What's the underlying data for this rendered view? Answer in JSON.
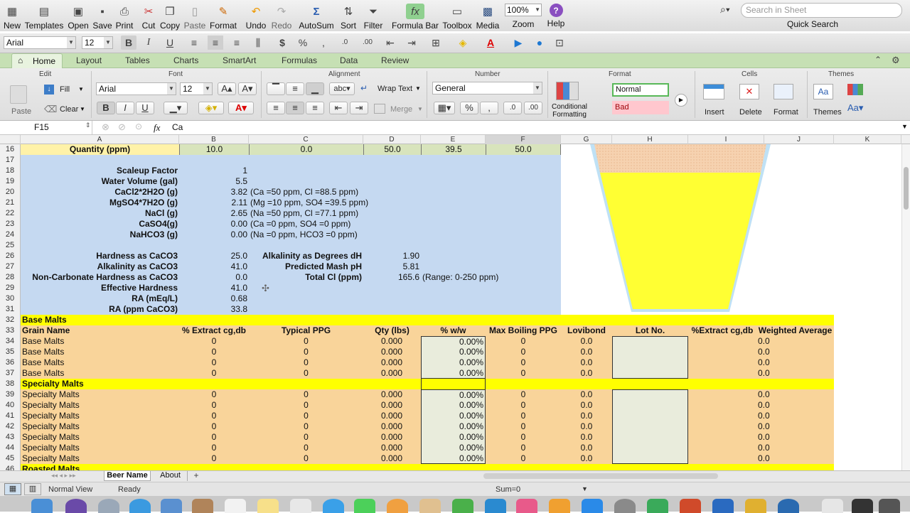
{
  "toolbar": {
    "items": [
      {
        "label": "New",
        "icon": "new-workbook-icon"
      },
      {
        "label": "Templates",
        "icon": "templates-icon"
      },
      {
        "label": "Open",
        "icon": "open-icon"
      },
      {
        "label": "Save",
        "icon": "save-icon"
      },
      {
        "label": "Print",
        "icon": "print-icon"
      },
      {
        "label": "Cut",
        "icon": "cut-icon"
      },
      {
        "label": "Copy",
        "icon": "copy-icon"
      },
      {
        "label": "Paste",
        "icon": "paste-icon"
      },
      {
        "label": "Format",
        "icon": "format-painter-icon"
      },
      {
        "label": "Undo",
        "icon": "undo-icon"
      },
      {
        "label": "Redo",
        "icon": "redo-icon"
      },
      {
        "label": "AutoSum",
        "icon": "autosum-icon"
      },
      {
        "label": "Sort",
        "icon": "sort-icon"
      },
      {
        "label": "Filter",
        "icon": "filter-icon"
      },
      {
        "label": "Formula Bar",
        "icon": "formula-bar-icon"
      },
      {
        "label": "Toolbox",
        "icon": "toolbox-icon"
      },
      {
        "label": "Media",
        "icon": "media-icon"
      },
      {
        "label": "Zoom",
        "icon": "zoom-icon"
      },
      {
        "label": "Help",
        "icon": "help-icon"
      }
    ],
    "zoom_value": "100%",
    "search_placeholder": "Search in Sheet",
    "quick_search": "Quick Search"
  },
  "format_bar": {
    "font": "Arial",
    "size": "12"
  },
  "ribbon": {
    "tabs": [
      "Home",
      "Layout",
      "Tables",
      "Charts",
      "SmartArt",
      "Formulas",
      "Data",
      "Review"
    ],
    "groups": {
      "edit": "Edit",
      "font": "Font",
      "alignment": "Alignment",
      "number": "Number",
      "format": "Format",
      "cells": "Cells",
      "themes": "Themes"
    },
    "paste": "Paste",
    "fill": "Fill",
    "clear": "Clear",
    "font": "Arial",
    "size": "12",
    "wrap_text": "Wrap Text",
    "merge": "Merge",
    "number_format": "General",
    "conditional_formatting": "Conditional Formatting",
    "style_normal": "Normal",
    "style_bad": "Bad",
    "insert": "Insert",
    "delete": "Delete",
    "format": "Format",
    "themes": "Themes"
  },
  "formula_bar": {
    "cell_ref": "F15",
    "fx": "fx",
    "content": "Ca"
  },
  "columns": [
    "A",
    "B",
    "C",
    "D",
    "E",
    "F",
    "G",
    "H",
    "I",
    "J",
    "K"
  ],
  "rows": {
    "r16": {
      "num": "16",
      "a": "Quantity (ppm)",
      "b": "10.0",
      "c": "0.0",
      "d": "50.0",
      "e": "39.5",
      "f": "50.0"
    },
    "r17": {
      "num": "17"
    },
    "r18": {
      "num": "18",
      "a": "Scaleup Factor",
      "b": "1"
    },
    "r19": {
      "num": "19",
      "a": "Water Volume (gal)",
      "b": "5.5"
    },
    "r20": {
      "num": "20",
      "a": "CaCl2*2H2O (g)",
      "b": "3.82",
      "c": "(Ca =50 ppm, Cl =88.5 ppm)"
    },
    "r21": {
      "num": "21",
      "a": "MgSO4*7H2O (g)",
      "b": "2.11",
      "c": "(Mg =10 ppm, SO4 =39.5 ppm)"
    },
    "r22": {
      "num": "22",
      "a": "NaCl (g)",
      "b": "2.65",
      "c": "(Na =50 ppm, Cl =77.1 ppm)"
    },
    "r23": {
      "num": "23",
      "a": "CaSO4(g)",
      "b": "0.00",
      "c": "(Ca =0 ppm, SO4 =0 ppm)"
    },
    "r24": {
      "num": "24",
      "a": "NaHCO3 (g)",
      "b": "0.00",
      "c": "(Na =0 ppm, HCO3 =0 ppm)"
    },
    "r25": {
      "num": "25"
    },
    "r26": {
      "num": "26",
      "a": "Hardness as CaCO3",
      "b": "25.0",
      "c": "Alkalinity as Degrees dH",
      "d": "1.90"
    },
    "r27": {
      "num": "27",
      "a": "Alkalinity as CaCO3",
      "b": "41.0",
      "c": "Predicted Mash pH",
      "d": "5.81"
    },
    "r28": {
      "num": "28",
      "a": "Non-Carbonate Hardness as CaCO3",
      "b": "0.0",
      "c": "Total Cl (ppm)",
      "d": "165.6",
      "e": "(Range: 0-250 ppm)"
    },
    "r29": {
      "num": "29",
      "a": "Effective Hardness",
      "b": "41.0"
    },
    "r30": {
      "num": "30",
      "a": "RA (mEq/L)",
      "b": "0.68"
    },
    "r31": {
      "num": "31",
      "a": "RA (ppm CaCO3)",
      "b": "33.8"
    },
    "r32": {
      "num": "32",
      "a": "Base Malts"
    },
    "r33": {
      "num": "33",
      "a": "Grain Name",
      "b": "% Extract cg,db",
      "c": "Typical PPG",
      "d": "Qty (lbs)",
      "e": "% w/w",
      "f": "Max Boiling PPG",
      "g": "Lovibond",
      "h": "Lot No.",
      "i": "%Extract cg,db",
      "j": "Weighted Average"
    },
    "r34": {
      "num": "34",
      "a": "Base Malts",
      "b": "0",
      "c": "0",
      "d": "0.000",
      "e": "0.00%",
      "f": "0",
      "g": "0.0",
      "j": "0.0"
    },
    "r35": {
      "num": "35",
      "a": "Base Malts",
      "b": "0",
      "c": "0",
      "d": "0.000",
      "e": "0.00%",
      "f": "0",
      "g": "0.0",
      "j": "0.0"
    },
    "r36": {
      "num": "36",
      "a": "Base Malts",
      "b": "0",
      "c": "0",
      "d": "0.000",
      "e": "0.00%",
      "f": "0",
      "g": "0.0",
      "j": "0.0"
    },
    "r37": {
      "num": "37",
      "a": "Base Malts",
      "b": "0",
      "c": "0",
      "d": "0.000",
      "e": "0.00%",
      "f": "0",
      "g": "0.0",
      "j": "0.0"
    },
    "r38": {
      "num": "38",
      "a": "Specialty Malts"
    },
    "r39": {
      "num": "39",
      "a": "Specialty Malts",
      "b": "0",
      "c": "0",
      "d": "0.000",
      "e": "0.00%",
      "f": "0",
      "g": "0.0",
      "j": "0.0"
    },
    "r40": {
      "num": "40",
      "a": "Specialty Malts",
      "b": "0",
      "c": "0",
      "d": "0.000",
      "e": "0.00%",
      "f": "0",
      "g": "0.0",
      "j": "0.0"
    },
    "r41": {
      "num": "41",
      "a": "Specialty Malts",
      "b": "0",
      "c": "0",
      "d": "0.000",
      "e": "0.00%",
      "f": "0",
      "g": "0.0",
      "j": "0.0"
    },
    "r42": {
      "num": "42",
      "a": "Specialty Malts",
      "b": "0",
      "c": "0",
      "d": "0.000",
      "e": "0.00%",
      "f": "0",
      "g": "0.0",
      "j": "0.0"
    },
    "r43": {
      "num": "43",
      "a": "Specialty Malts",
      "b": "0",
      "c": "0",
      "d": "0.000",
      "e": "0.00%",
      "f": "0",
      "g": "0.0",
      "j": "0.0"
    },
    "r44": {
      "num": "44",
      "a": "Specialty Malts",
      "b": "0",
      "c": "0",
      "d": "0.000",
      "e": "0.00%",
      "f": "0",
      "g": "0.0",
      "j": "0.0"
    },
    "r45": {
      "num": "45",
      "a": "Specialty Malts",
      "b": "0",
      "c": "0",
      "d": "0.000",
      "e": "0.00%",
      "f": "0",
      "g": "0.0",
      "j": "0.0"
    },
    "r46": {
      "num": "46",
      "a": "Roasted Malts"
    }
  },
  "sheet_tabs": [
    "Beer Name",
    "About"
  ],
  "status": {
    "view": "Normal View",
    "state": "Ready",
    "sum": "Sum=0"
  },
  "colors": {
    "blue_fill": "#c5d9f1",
    "orange_fill": "#f9d49a",
    "yellow_fill": "#ffff00",
    "header_yellow": "#fff2a8",
    "beer_yellow": "#ffff33",
    "tab_green": "#c6e0b4"
  }
}
